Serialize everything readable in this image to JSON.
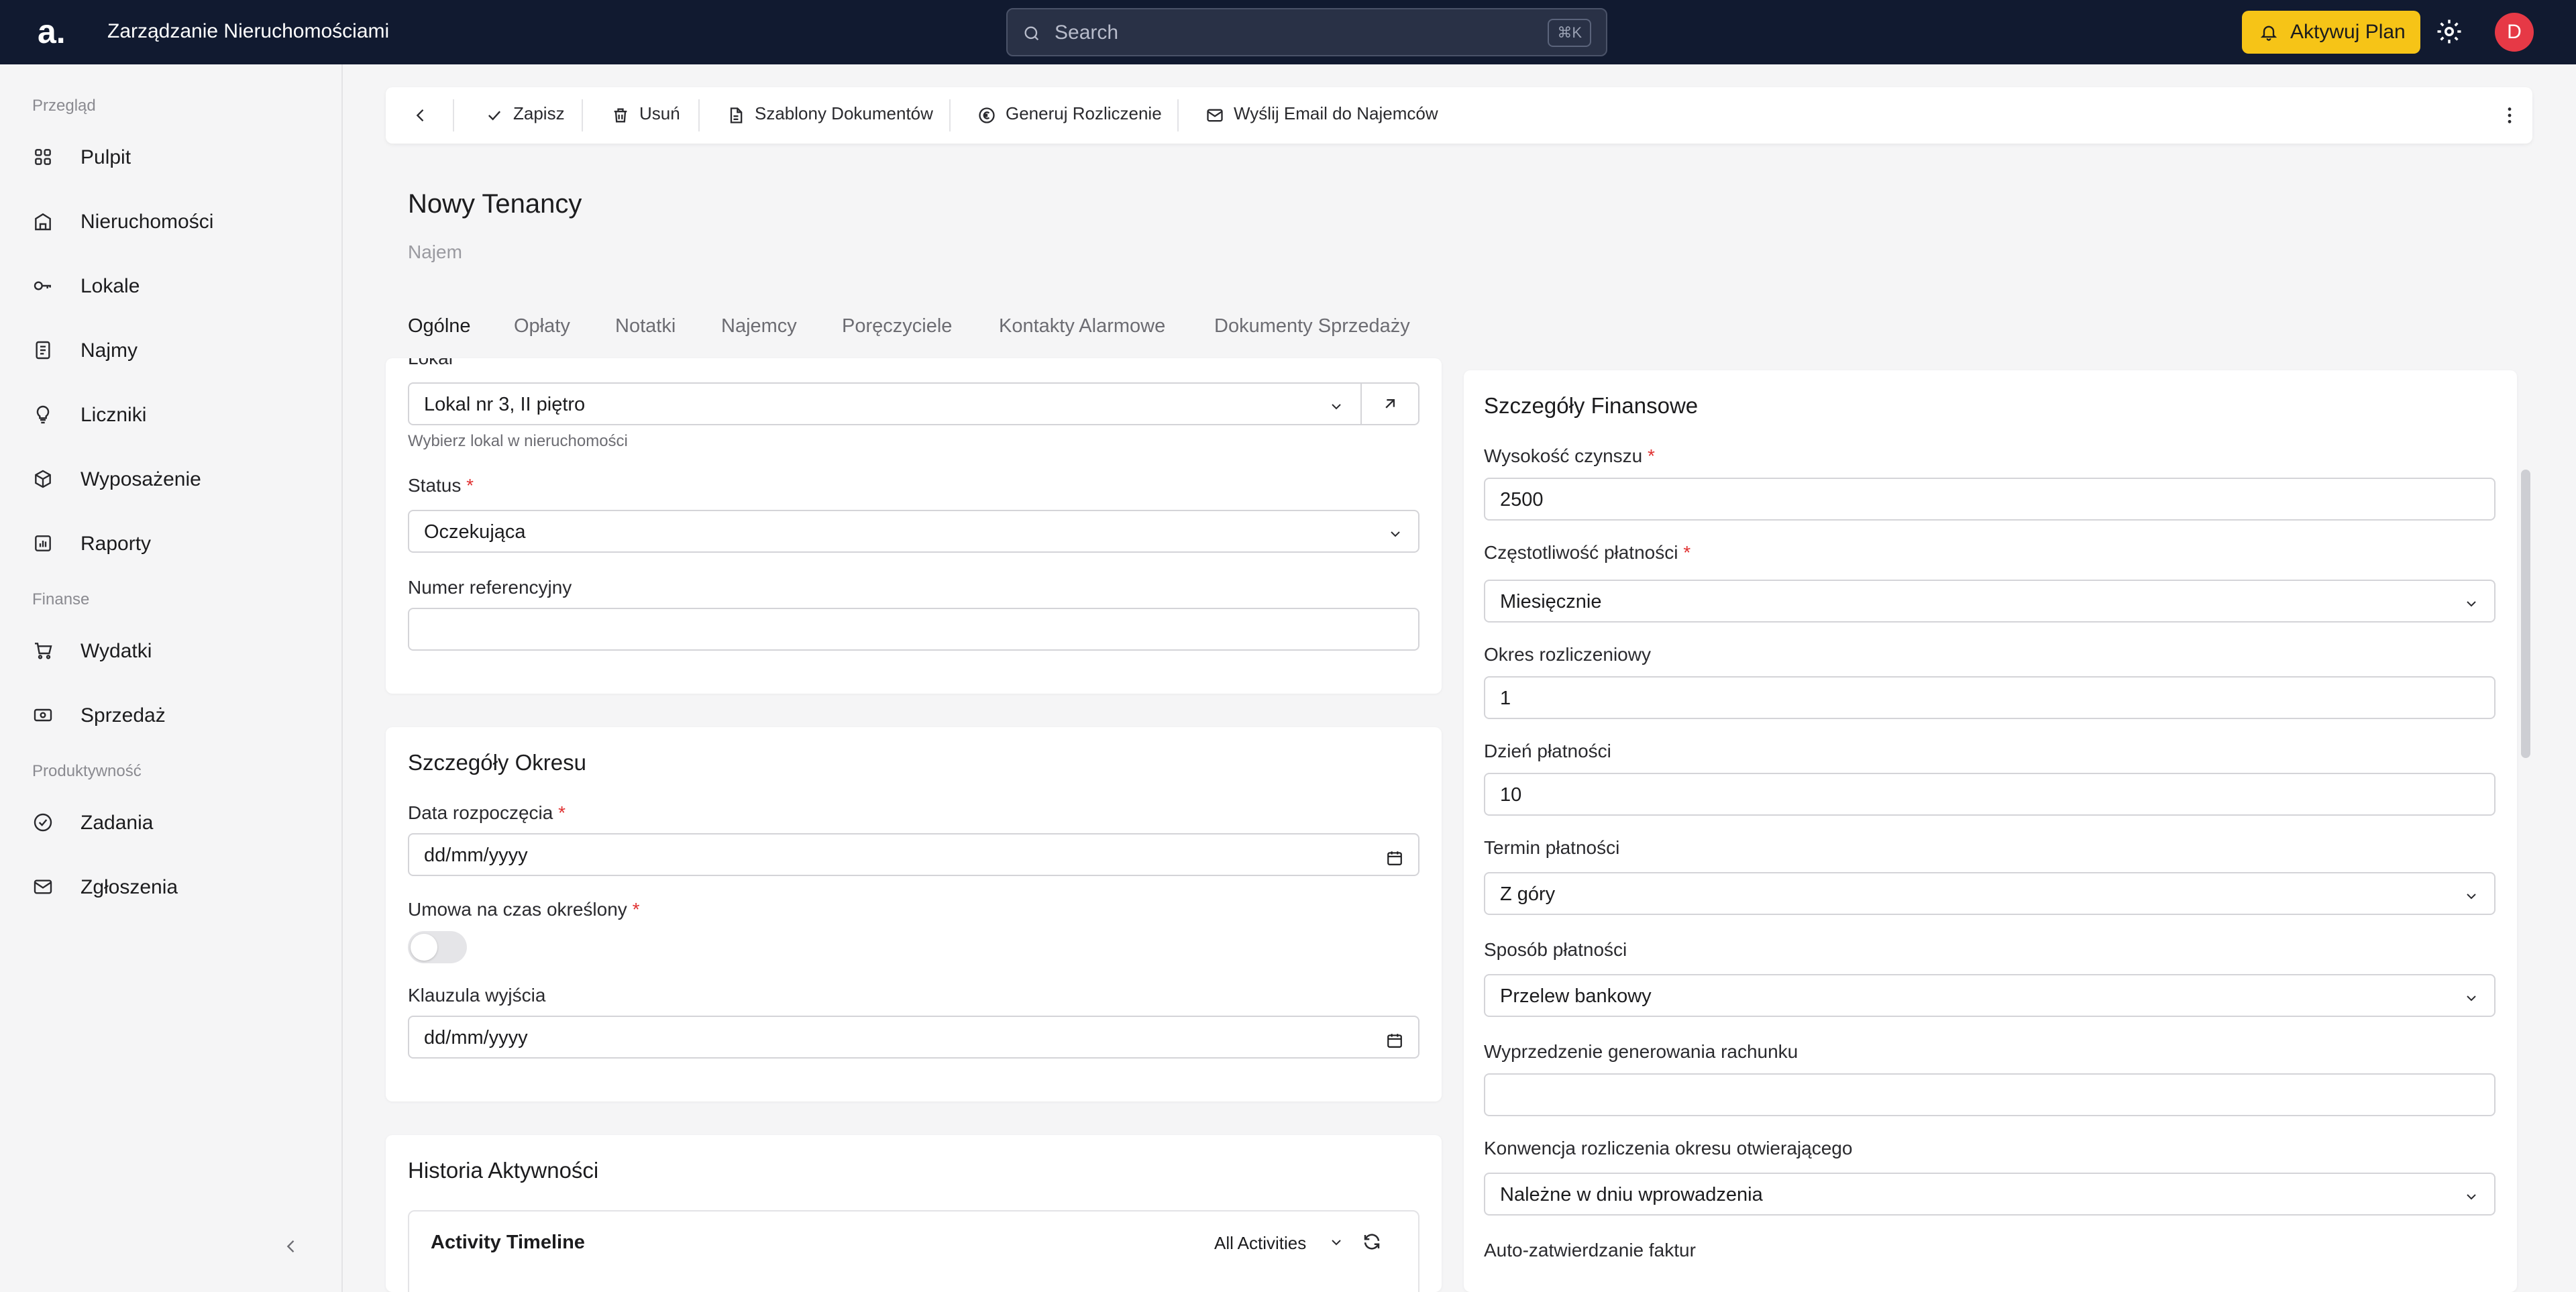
{
  "topbar": {
    "logo": "a.",
    "app_title": "Zarządzanie Nieruchomościami",
    "search_placeholder": "Search",
    "search_shortcut": "⌘K",
    "cta_label": "Aktywuj Plan",
    "avatar_initial": "D"
  },
  "sidebar": {
    "section_overview": "Przegląd",
    "section_finance": "Finanse",
    "section_productivity": "Produktywność",
    "items": [
      {
        "label": "Pulpit",
        "icon": "grid-icon"
      },
      {
        "label": "Nieruchomości",
        "icon": "building-icon"
      },
      {
        "label": "Lokale",
        "icon": "key-icon"
      },
      {
        "label": "Najmy",
        "icon": "document-icon"
      },
      {
        "label": "Liczniki",
        "icon": "bulb-icon"
      },
      {
        "label": "Wyposażenie",
        "icon": "box-icon"
      },
      {
        "label": "Raporty",
        "icon": "chart-icon"
      },
      {
        "label": "Wydatki",
        "icon": "cart-icon"
      },
      {
        "label": "Sprzedaż",
        "icon": "money-icon"
      },
      {
        "label": "Zadania",
        "icon": "check-circle-icon"
      },
      {
        "label": "Zgłoszenia",
        "icon": "mail-icon"
      }
    ]
  },
  "toolbar": {
    "save": "Zapisz",
    "delete": "Usuń",
    "templates": "Szablony Dokumentów",
    "generate": "Generuj Rozliczenie",
    "email": "Wyślij Email do Najemców"
  },
  "page": {
    "title": "Nowy Tenancy",
    "subtitle": "Najem"
  },
  "tabs": [
    "Ogólne",
    "Opłaty",
    "Notatki",
    "Najemcy",
    "Poręczyciele",
    "Kontakty Alarmowe",
    "Dokumenty Sprzedaży"
  ],
  "general": {
    "lokal_label": "Lokal",
    "lokal_value": "Lokal nr 3,  II piętro",
    "lokal_hint": "Wybierz lokal w nieruchomości",
    "status_label": "Status",
    "status_value": "Oczekująca",
    "ref_label": "Numer referencyjny",
    "ref_value": ""
  },
  "period": {
    "title": "Szczegóły Okresu",
    "start_label": "Data rozpoczęcia",
    "start_value": "dd/mm/yyyy",
    "fixed_label": "Umowa na czas określony",
    "fixed_on": false,
    "exit_label": "Klauzula wyjścia",
    "exit_value": "dd/mm/yyyy"
  },
  "history": {
    "title": "Historia Aktywności",
    "timeline_title": "Activity Timeline",
    "filter_value": "All Activities"
  },
  "finance": {
    "title": "Szczegóły Finansowe",
    "rent_label": "Wysokość czynszu",
    "rent_value": "2500",
    "freq_label": "Częstotliwość płatności",
    "freq_value": "Miesięcznie",
    "period_label": "Okres rozliczeniowy",
    "period_value": "1",
    "day_label": "Dzień płatności",
    "day_value": "10",
    "term_label": "Termin płatności",
    "term_value": "Z góry",
    "method_label": "Sposób płatności",
    "method_value": "Przelew bankowy",
    "advance_label": "Wyprzedzenie generowania rachunku",
    "advance_value": "",
    "convention_label": "Konwencja rozliczenia okresu otwierającego",
    "convention_value": "Należne w dniu wprowadzenia",
    "auto_label": "Auto-zatwierdzanie faktur"
  },
  "colors": {
    "topbar": "#111a30",
    "accent": "#f6c417",
    "avatar": "#e63946",
    "required": "#e03131"
  }
}
